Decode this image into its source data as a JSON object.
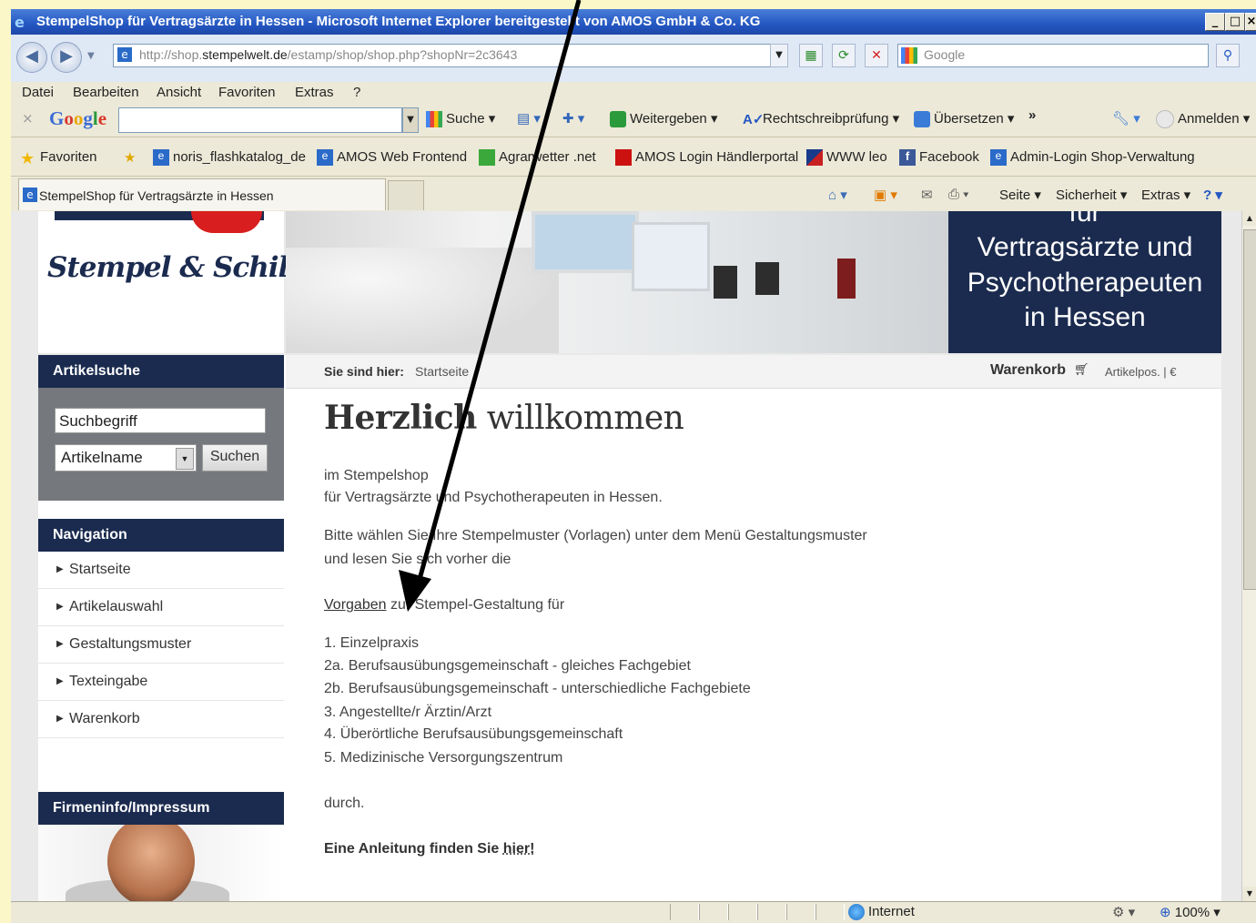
{
  "window": {
    "title": "StempelShop für Vertragsärzte in Hessen - Microsoft Internet Explorer bereitgestellt von AMOS GmbH & Co. KG",
    "controls": [
      "_",
      "□",
      "×"
    ]
  },
  "address": {
    "url_prefix": "http://shop.",
    "url_domain": "stempelwelt.de",
    "url_rest": "/estamp/shop/shop.php?shopNr=2c3643",
    "search_placeholder": "Google"
  },
  "menu": {
    "items": [
      "Datei",
      "Bearbeiten",
      "Ansicht",
      "Favoriten",
      "Extras",
      "?"
    ]
  },
  "google_toolbar": {
    "logo": "Google",
    "search": "Suche",
    "share": "Weitergeben",
    "spell": "Rechtschreibprüfung",
    "translate": "Übersetzen",
    "more": "»",
    "signin": "Anmelden"
  },
  "favorites": {
    "label": "Favoriten",
    "items": [
      "noris_flashkatalog_de",
      "AMOS Web Frontend",
      "Agrarwetter .net",
      "AMOS Login Händlerportal",
      "WWW leo",
      "Facebook",
      "Admin-Login Shop-Verwaltung"
    ]
  },
  "tabs": {
    "active": "StempelShop für Vertragsärzte in Hessen",
    "page_menu": "Seite",
    "security_menu": "Sicherheit",
    "tools_menu": "Extras"
  },
  "site": {
    "logo_text": "Stempel & Schilder",
    "banner": [
      "für",
      "Vertragsärzte und",
      "Psychotherapeuten",
      "in Hessen"
    ],
    "sidebar": {
      "search_title": "Artikelsuche",
      "search_value": "Suchbegriff",
      "select_value": "Artikelname",
      "search_button": "Suchen",
      "nav_title": "Navigation",
      "nav_items": [
        "Startseite",
        "Artikelauswahl",
        "Gestaltungsmuster",
        "Texteingabe",
        "Warenkorb"
      ],
      "firm_title": "Firmeninfo/Impressum"
    },
    "breadcrumb": {
      "label": "Sie sind hier:",
      "current": "Startseite",
      "cart_label": "Warenkorb",
      "cart_info": "Artikelpos. | €"
    },
    "heading_bold": "Herzlich",
    "heading_rest": " willkommen",
    "intro_1": "im Stempelshop",
    "intro_2": "für Vertragsärzte und Psychotherapeuten in Hessen.",
    "body_1": "Bitte wählen Sie Ihre Stempelmuster (Vorlagen) unter dem Menü Gestaltungsmuster",
    "body_2": "und lesen Sie sich vorher die",
    "link_vorgaben": "Vorgaben",
    "body_3": " zur Stempel-Gestaltung für",
    "list": [
      "1.   Einzelpraxis",
      "2a. Berufsausübungsgemeinschaft - gleiches Fachgebiet",
      "2b. Berufsausübungsgemeinschaft - unterschiedliche Fachgebiete",
      "3.   Angestellte/r Ärztin/Arzt",
      "4.   Überörtliche Berufsausübungsgemeinschaft",
      "5.   Medizinische Versorgungszentrum"
    ],
    "durch": "durch.",
    "guide_text": "Eine Anleitung finden Sie ",
    "guide_link": "hier!"
  },
  "status": {
    "zone": "Internet",
    "zoom": "100%"
  }
}
